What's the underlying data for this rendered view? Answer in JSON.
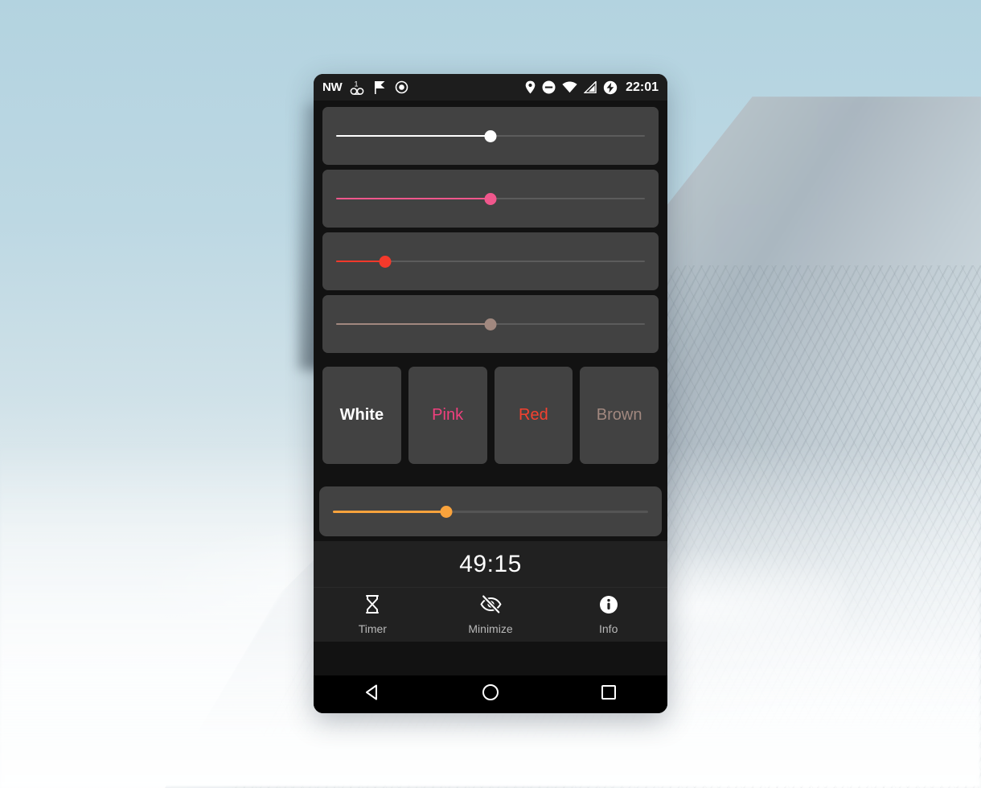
{
  "status_bar": {
    "carrier": "NW",
    "time": "22:01",
    "left_icons": [
      "carrier-label-nw",
      "voicemail-count-icon",
      "flag-check-icon",
      "record-dot-icon"
    ],
    "voicemail_count": "1",
    "right_icons": [
      "location-pin-icon",
      "do-not-disturb-icon",
      "wifi-icon",
      "cellular-signal-icon",
      "battery-charging-icon"
    ]
  },
  "sliders": [
    {
      "name": "white-filter-slider",
      "color": "#FFFFFF",
      "thumb_color": "#FFFFFF",
      "track_color": "#5C5C5C",
      "value_percent": 50
    },
    {
      "name": "pink-filter-slider",
      "color": "#F0578C",
      "thumb_color": "#F0578C",
      "track_color": "#5C5C5C",
      "value_percent": 50
    },
    {
      "name": "red-filter-slider",
      "color": "#F4392B",
      "thumb_color": "#F4392B",
      "track_color": "#5C5C5C",
      "value_percent": 16
    },
    {
      "name": "brown-filter-slider",
      "color": "#A1887F",
      "thumb_color": "#A1887F",
      "track_color": "#5C5C5C",
      "value_percent": 50
    }
  ],
  "color_buttons": [
    {
      "label": "White",
      "color": "#FFFFFF",
      "selected": true
    },
    {
      "label": "Pink",
      "color": "#F0407E",
      "selected": false
    },
    {
      "label": "Red",
      "color": "#F4412F",
      "selected": false
    },
    {
      "label": "Brown",
      "color": "#A1887F",
      "selected": false
    }
  ],
  "brightness_slider": {
    "name": "brightness-slider",
    "color": "#FAA33C",
    "track_color": "#555555",
    "value_percent": 36
  },
  "timer": {
    "value": "49:15"
  },
  "bottom_nav": [
    {
      "label": "Timer",
      "icon": "hourglass-icon"
    },
    {
      "label": "Minimize",
      "icon": "eye-off-icon"
    },
    {
      "label": "Info",
      "icon": "info-circle-icon"
    }
  ],
  "system_nav": [
    {
      "name": "back-button",
      "icon": "triangle-left-icon"
    },
    {
      "name": "home-button",
      "icon": "circle-icon"
    },
    {
      "name": "recents-button",
      "icon": "square-icon"
    }
  ]
}
